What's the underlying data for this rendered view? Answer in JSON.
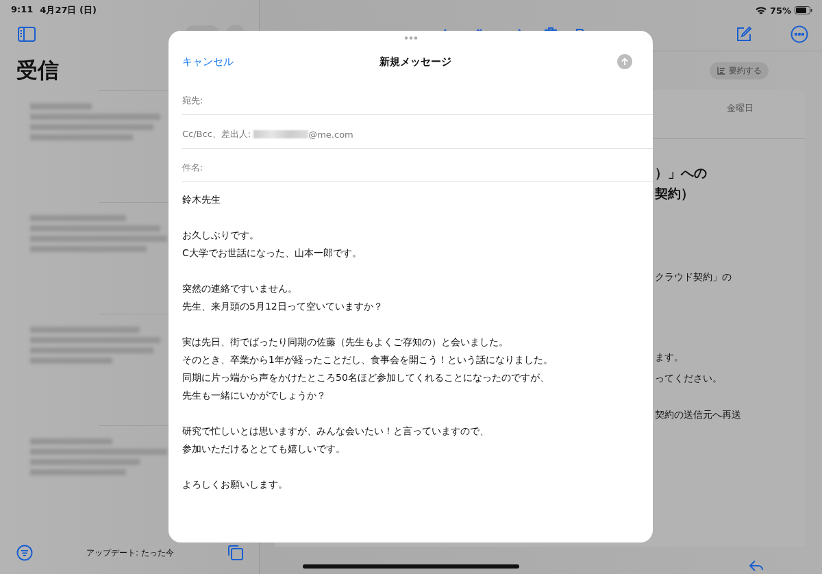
{
  "status_bar": {
    "time": "9:11",
    "date": "4月27日 (日)",
    "battery": "75%"
  },
  "mailbox": {
    "title": "受信",
    "updated": "アップデート: たった今"
  },
  "message_pane": {
    "summarize": "要約する",
    "date": "金曜日",
    "paragraphs": [
      {
        "kind": "heading",
        "lines": [
          "）」への",
          "契約）"
        ]
      },
      {
        "kind": "text",
        "lines": [
          "クラウド契約」の"
        ]
      },
      {
        "kind": "text",
        "lines": [
          "ます。",
          "ってください。"
        ]
      },
      {
        "kind": "text",
        "lines": [
          "契約の送信元へ再送"
        ]
      }
    ]
  },
  "compose": {
    "cancel": "キャンセル",
    "title": "新規メッセージ",
    "send_enabled": false,
    "fields": [
      {
        "label": "宛先:"
      },
      {
        "label": "Cc/Bcc、差出人:",
        "value": "@me.com",
        "redacted": true
      },
      {
        "label": "件名:"
      }
    ],
    "body": [
      [
        "鈴木先生"
      ],
      [
        "お久しぶりです。",
        "C大学でお世話になった、山本一郎です。"
      ],
      [
        "突然の連絡ですいません。",
        "先生、来月頭の5月12日って空いていますか？"
      ],
      [
        "実は先日、街でばったり同期の佐藤（先生もよくご存知の）と会いました。",
        "そのとき、卒業から1年が経ったことだし、食事会を開こう！という話になりました。",
        "同期に片っ端から声をかけたところ50名ほど参加してくれることになったのですが、",
        "先生も一緒にいかがでしょうか？"
      ],
      [
        "研究で忙しいとは思いますが、みんな会いたい！と言っていますので、",
        "参加いただけるととても嬉しいです。"
      ],
      [
        "よろしくお願いします。"
      ]
    ]
  }
}
